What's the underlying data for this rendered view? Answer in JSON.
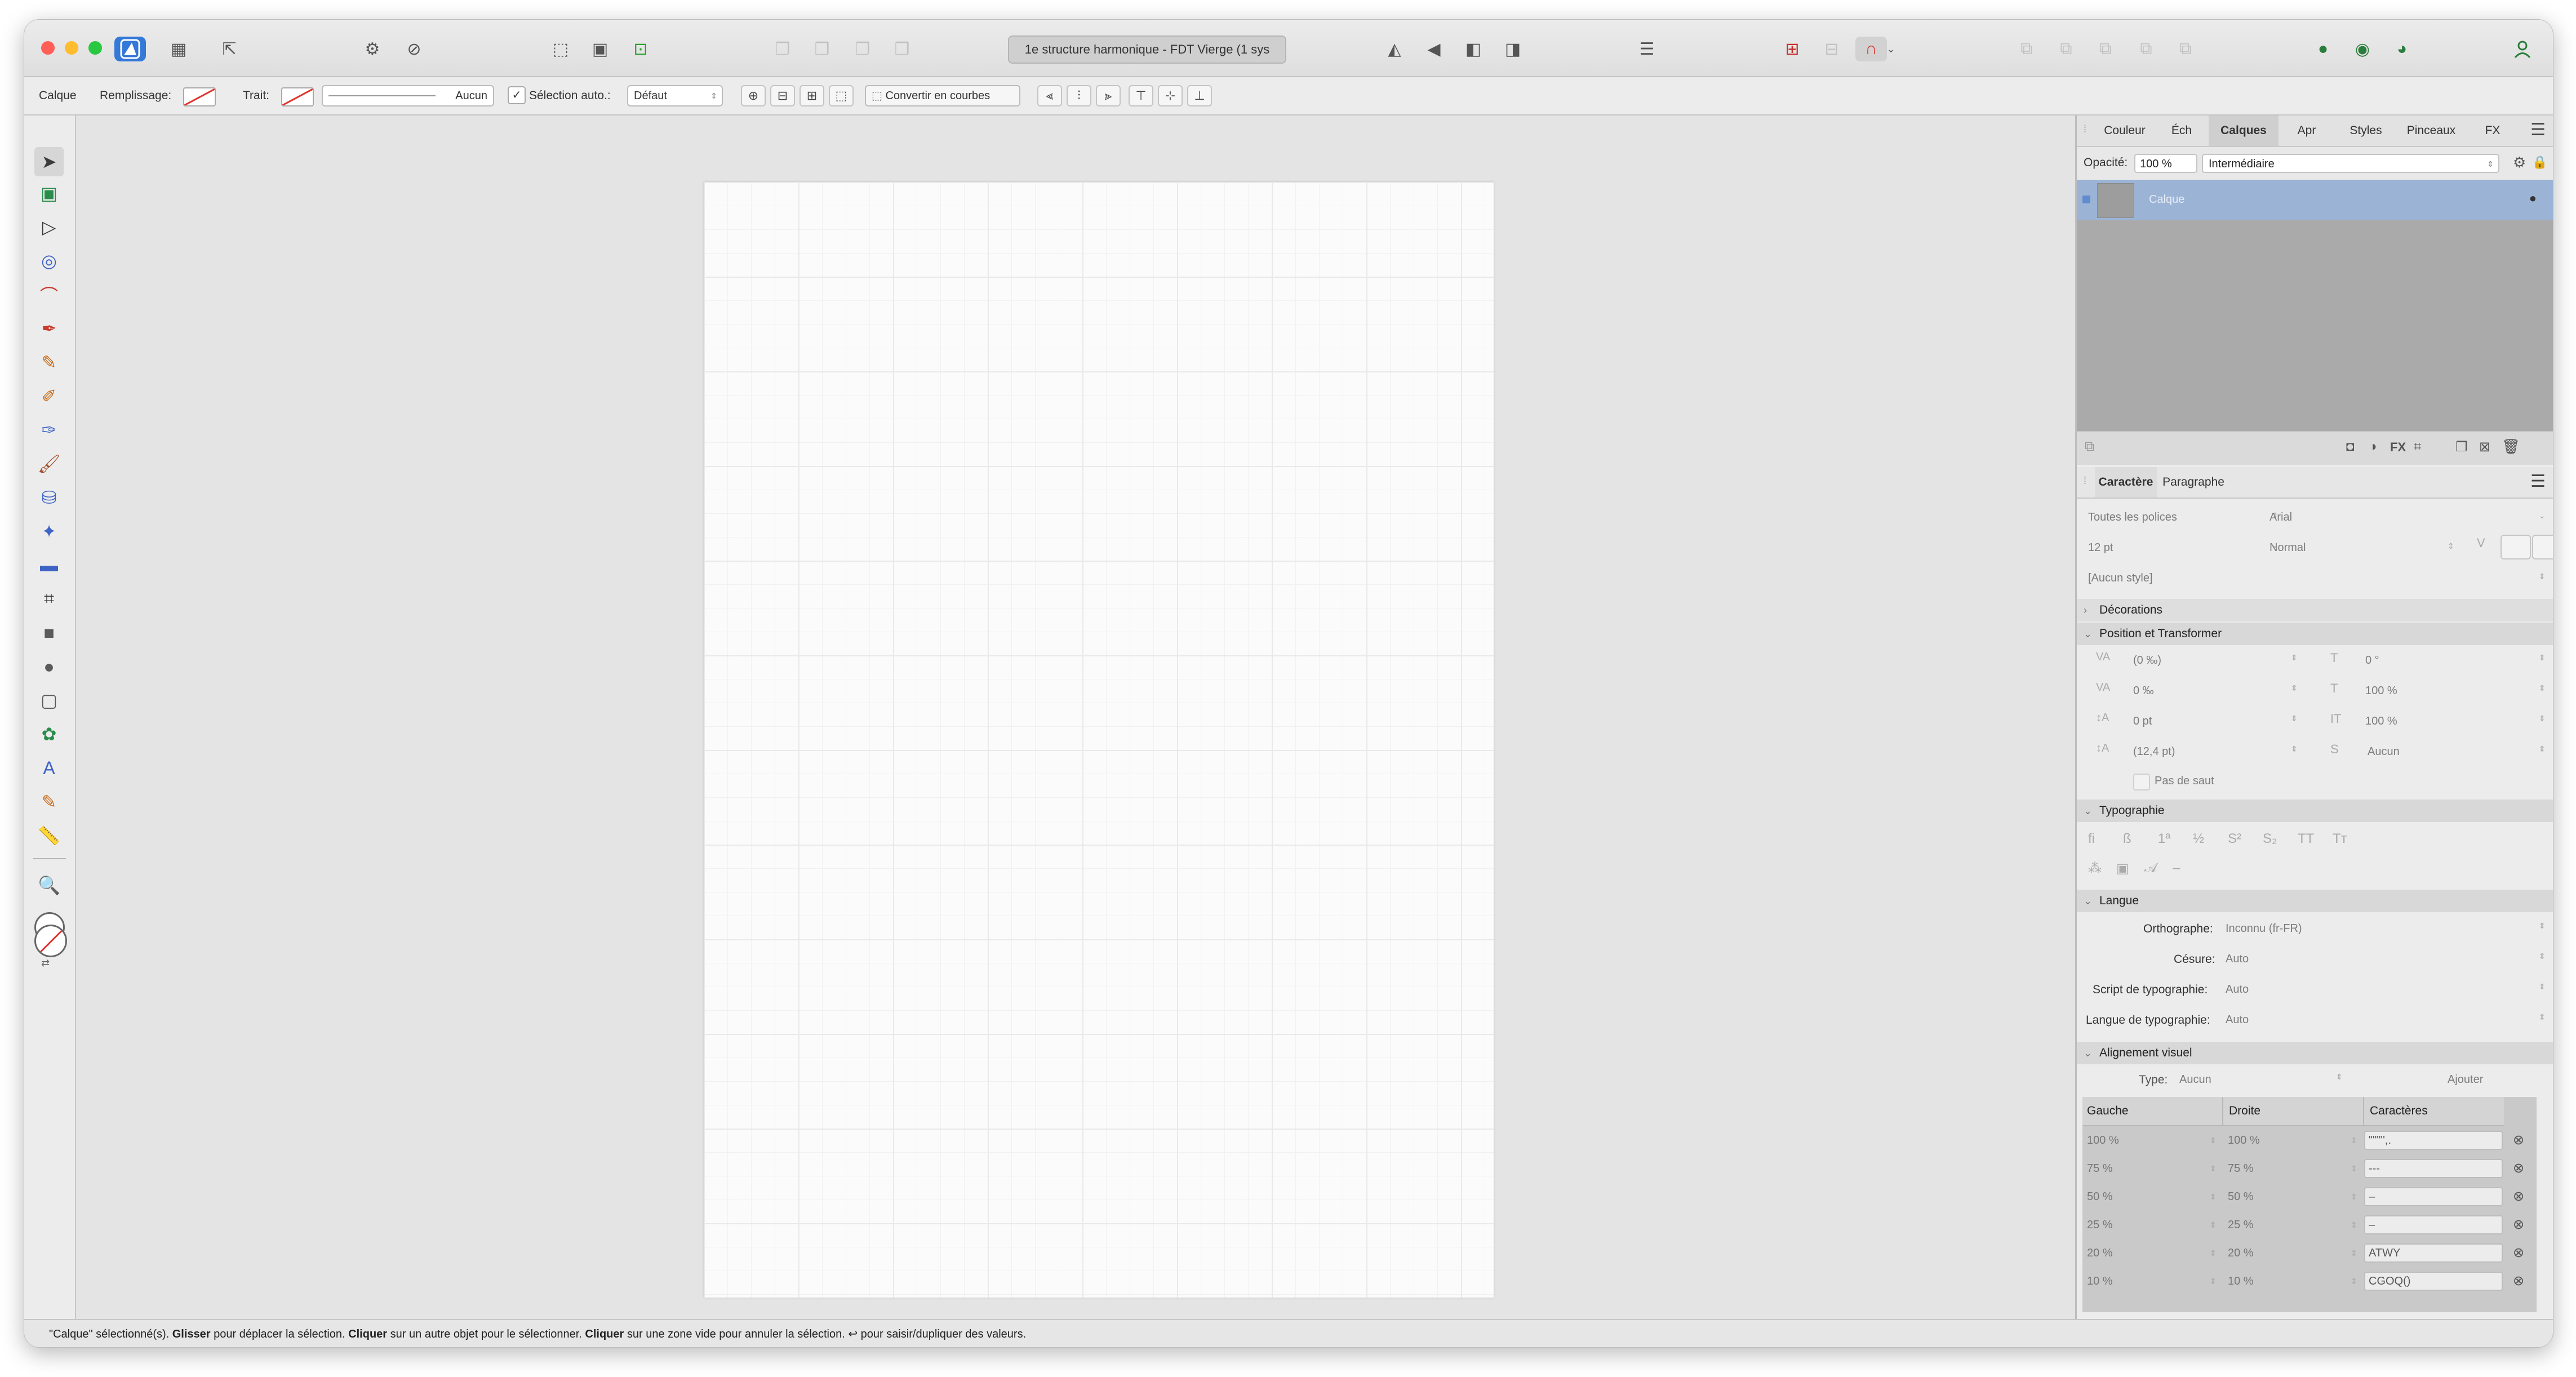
{
  "window": {
    "doc_title": "1e structure harmonique - FDT Vierge (1 sys"
  },
  "context_toolbar": {
    "layer_label": "Calque",
    "fill_label": "Remplissage:",
    "stroke_label": "Trait:",
    "stroke_width_value": "Aucun",
    "auto_select_label": "Sélection auto.:",
    "auto_select_value": "Défaut",
    "convert_label": "Convertir en courbes"
  },
  "layers_panel": {
    "tabs": [
      "Couleur",
      "Éch",
      "Calques",
      "Apr",
      "Styles",
      "Pinceaux",
      "FX"
    ],
    "active_tab": "Calques",
    "opacity_label": "Opacité:",
    "opacity_value": "100 %",
    "blend_mode": "Intermédiaire",
    "layer_name": "Calque"
  },
  "character_panel": {
    "tabs": [
      "Caractère",
      "Paragraphe"
    ],
    "font_collection": "Toutes les polices",
    "font_family": "Arial",
    "font_size": "12 pt",
    "font_style": "Normal",
    "char_style": "[Aucun style]",
    "sections": {
      "decorations": "Décorations",
      "position": "Position et Transformer",
      "typography": "Typographie",
      "language": "Langue",
      "visual_alignment": "Alignement visuel"
    },
    "position_fields": {
      "kerning": "(0 ‰)",
      "tracking": "0 ‰",
      "baseline": "0 pt",
      "leading": "(12,4 pt)",
      "shear": "0 °",
      "vscale": "100 %",
      "hscale": "100 %",
      "leading_override": "Aucun",
      "no_break": "Pas de saut"
    },
    "language": {
      "spelling_label": "Orthographe:",
      "spelling_value": "Inconnu (fr-FR)",
      "hyphen_label": "Césure:",
      "hyphen_value": "Auto",
      "script_label": "Script de typographie:",
      "script_value": "Auto",
      "lang_label": "Langue de typographie:",
      "lang_value": "Auto"
    },
    "visual_alignment": {
      "type_label": "Type:",
      "type_value": "Aucun",
      "add_label": "Ajouter",
      "headers": [
        "Gauche",
        "Droite",
        "Caractères"
      ],
      "rows": [
        {
          "left": "100 %",
          "right": "100 %",
          "chars": "\"\"\"'',."
        },
        {
          "left": "75 %",
          "right": "75 %",
          "chars": "---"
        },
        {
          "left": "50 %",
          "right": "50 %",
          "chars": "–"
        },
        {
          "left": "25 %",
          "right": "25 %",
          "chars": "–"
        },
        {
          "left": "20 %",
          "right": "20 %",
          "chars": "ATWY"
        },
        {
          "left": "10 %",
          "right": "10 %",
          "chars": "CGOQ()"
        }
      ]
    }
  },
  "status_bar": {
    "p1": "\"Calque\" sélectionné(s). ",
    "b1": "Glisser",
    "p2": " pour déplacer la sélection. ",
    "b2": "Cliquer",
    "p3": " sur un autre objet pour le sélectionner. ",
    "b3": "Cliquer",
    "p4": " sur une zone vide pour annuler la sélection. ↩ pour saisir/dupliquer des valeurs."
  },
  "colors": {
    "selected_layer": "#9bb4d6",
    "accent": "#2f7bd9"
  }
}
